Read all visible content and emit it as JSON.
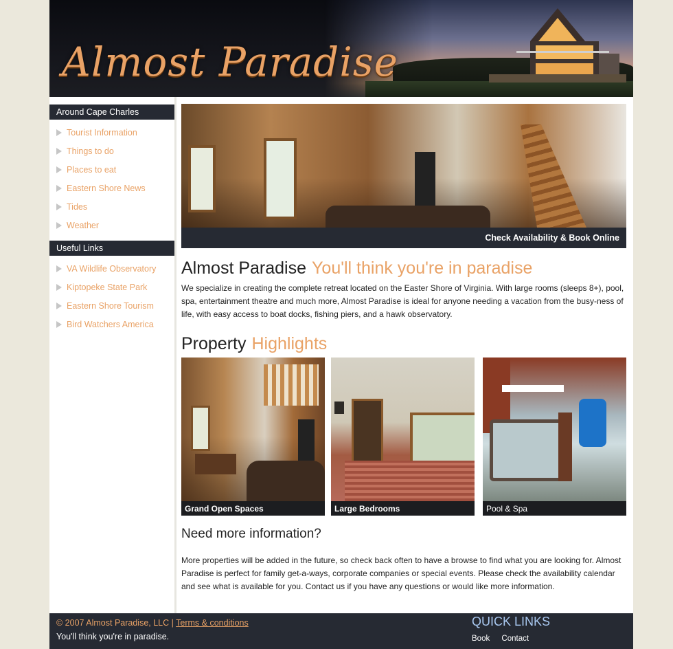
{
  "header": {
    "logo_text": "Almost Paradise"
  },
  "sidebar": {
    "sections": [
      {
        "title": "Around Cape Charles",
        "items": [
          "Tourist Information",
          "Things to do",
          "Places to eat",
          "Eastern Shore News",
          "Tides",
          "Weather"
        ]
      },
      {
        "title": "Useful Links",
        "items": [
          "VA Wildlife Observatory",
          "Kiptopeke State Park",
          "Eastern Shore Tourism",
          "Bird Watchers America"
        ]
      }
    ]
  },
  "hero": {
    "cta": "Check Availability & Book Online"
  },
  "intro": {
    "title": "Almost Paradise",
    "title_accent": "You'll think you're in paradise",
    "body": "We specialize in creating the complete retreat located on the Easter Shore of Virginia. With large rooms (sleeps 8+), pool, spa, entertainment theatre and much more, Almost Paradise is ideal for anyone needing a vacation from the busy-ness of life, with easy access to boat docks, fishing piers, and a hawk observatory."
  },
  "highlights": {
    "title": "Property",
    "title_accent": "Highlights",
    "items": [
      {
        "caption": "Grand Open Spaces"
      },
      {
        "caption": "Large Bedrooms"
      },
      {
        "caption": "Pool & Spa"
      }
    ]
  },
  "more_info": {
    "title": "Need more information?",
    "body": "More properties will be added in the future, so check back often to have a browse to find what you are looking for. Almost Paradise is perfect for family get-a-ways, corporate companies or special events. Please check the availability calendar and see what is available for you. Contact us if you have any questions or would like more information."
  },
  "footer": {
    "copyright": "© 2007 Almost Paradise, LLC |",
    "terms_link": "Terms & conditions",
    "tagline": "You'll think you're in paradise.",
    "quick_links_title": "QUICK LINKS",
    "quick_links": [
      "Book",
      "Contact"
    ]
  },
  "colors": {
    "accent": "#e9a266",
    "dark_bar": "#262a33",
    "page_bg": "#ebe8dc",
    "quick_links_title": "#a9c8f0"
  }
}
